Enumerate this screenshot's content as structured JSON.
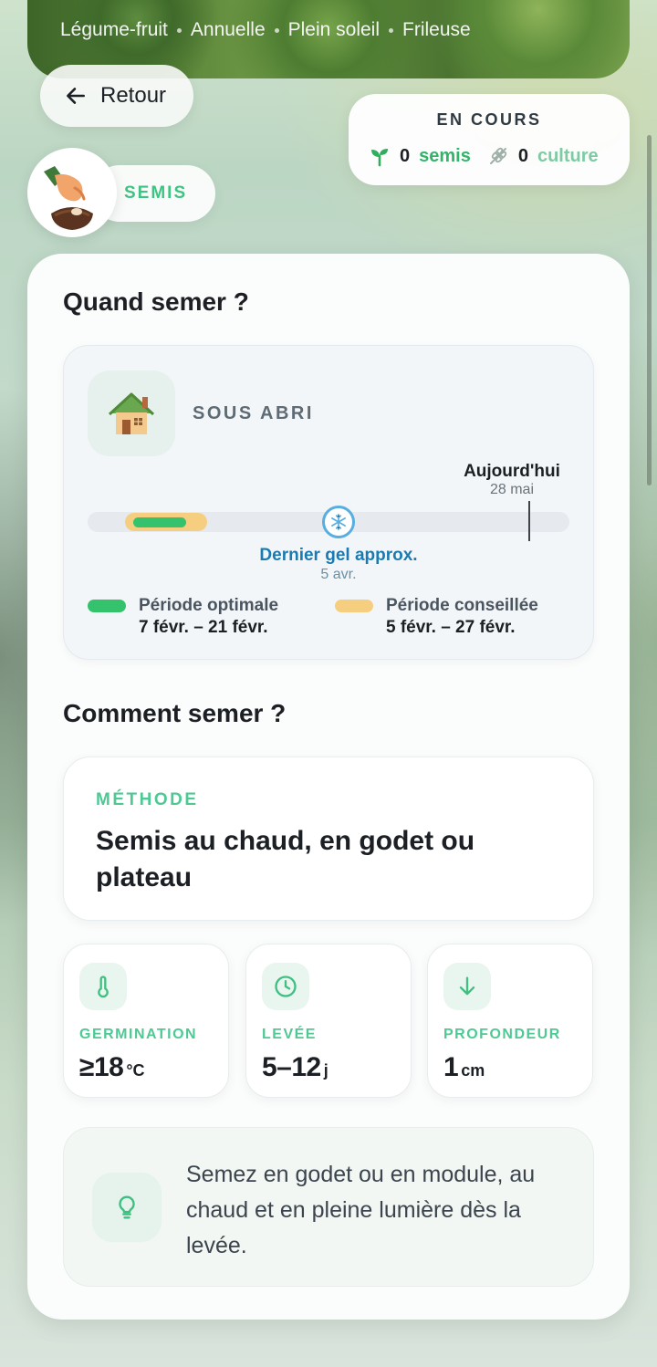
{
  "hero": {
    "tags": [
      "Légume-fruit",
      "Annuelle",
      "Plein soleil",
      "Frileuse"
    ]
  },
  "nav": {
    "back_label": "Retour"
  },
  "status": {
    "title": "EN COURS",
    "semis_count": "0",
    "semis_label": "semis",
    "culture_count": "0",
    "culture_label": "culture"
  },
  "stage": {
    "label": "SEMIS"
  },
  "when": {
    "title": "Quand semer ?",
    "mode": "SOUS ABRI",
    "today_label": "Aujourd'hui",
    "today_date": "28 mai",
    "frost_label": "Dernier gel approx.",
    "frost_date": "5 avr.",
    "legend": [
      {
        "name": "Période optimale",
        "range": "7 févr. – 21 févr.",
        "color": "#35c26c"
      },
      {
        "name": "Période conseillée",
        "range": "5 févr. – 27 févr.",
        "color": "#f5cf7f"
      }
    ]
  },
  "how": {
    "title": "Comment semer ?",
    "method_kicker": "MÉTHODE",
    "method_text": "Semis au chaud, en godet ou plateau",
    "stats": [
      {
        "icon": "thermometer-icon",
        "label": "GERMINATION",
        "value": "≥18",
        "unit": "°C"
      },
      {
        "icon": "clock-icon",
        "label": "LEVÉE",
        "value": "5–12",
        "unit": "j"
      },
      {
        "icon": "arrow-down-icon",
        "label": "PROFONDEUR",
        "value": "1",
        "unit": "cm"
      }
    ],
    "tip": "Semez en godet ou en module, au chaud et en pleine lumière dès la levée."
  },
  "colors": {
    "accent_green": "#3fc383",
    "frost_blue": "#1b7bb0"
  }
}
